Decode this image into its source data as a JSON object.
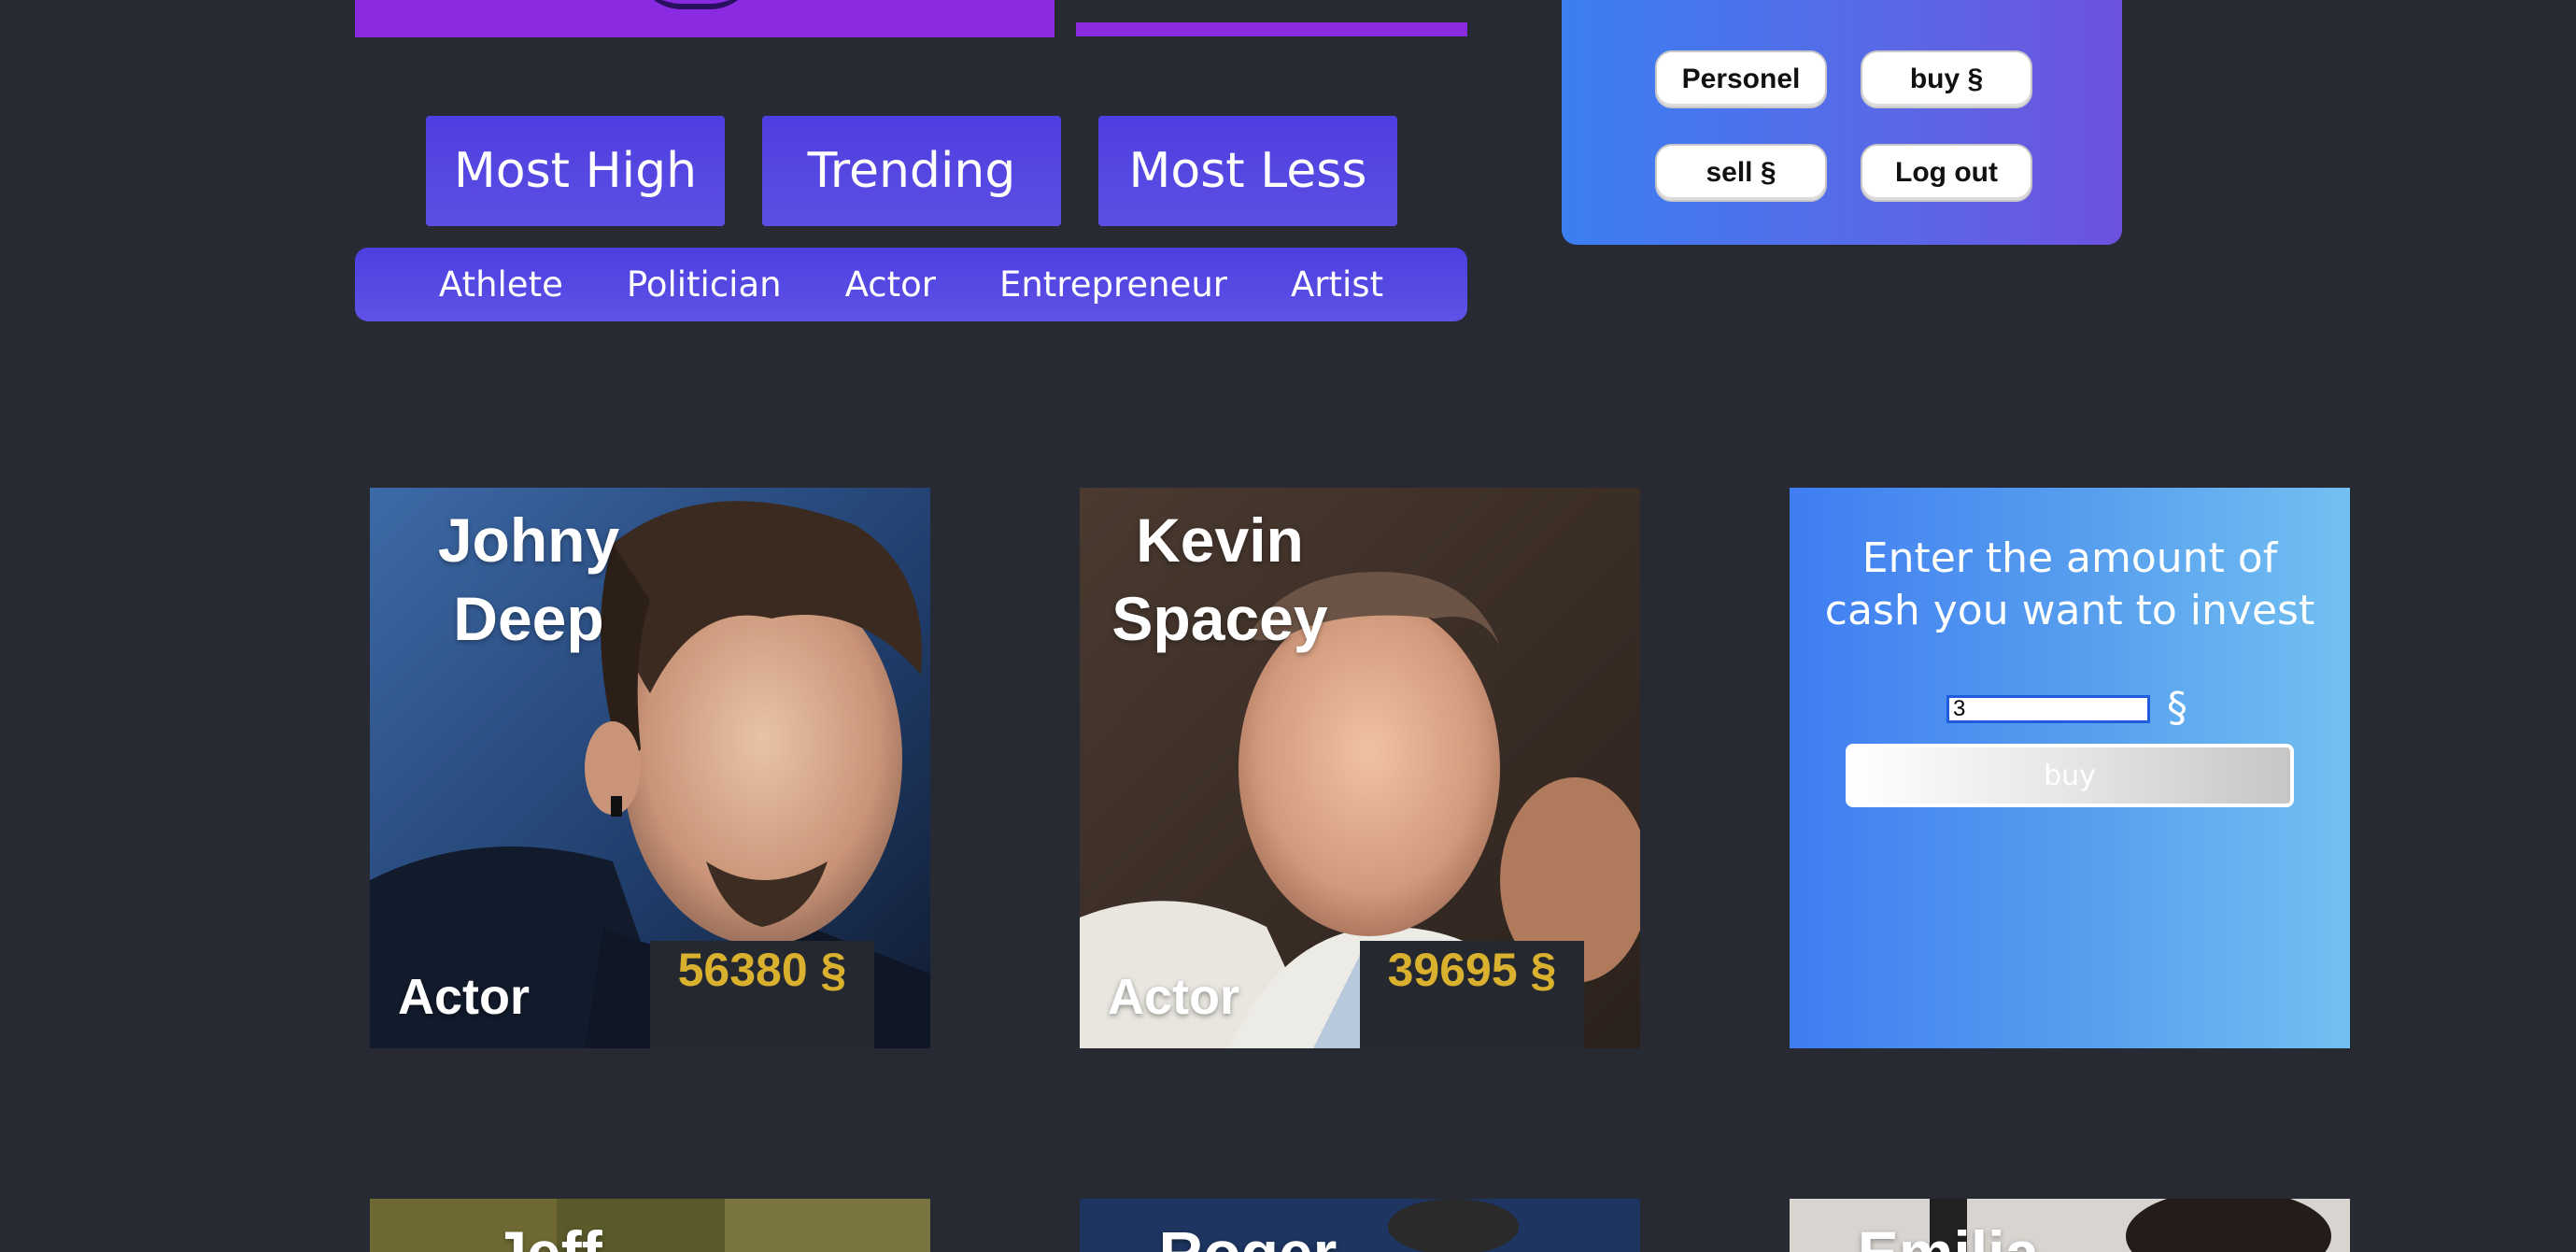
{
  "sort_buttons": [
    {
      "label": "Most High"
    },
    {
      "label": "Trending"
    },
    {
      "label": "Most Less"
    }
  ],
  "categories": [
    "Athlete",
    "Politician",
    "Actor",
    "Entrepreneur",
    "Artist"
  ],
  "user_menu": {
    "personel": "Personel",
    "buy": "buy §",
    "sell": "sell §",
    "logout": "Log out"
  },
  "cards": [
    {
      "first": "Johny",
      "last": "Deep",
      "category": "Actor",
      "price": "56380 §"
    },
    {
      "first": "Kevin",
      "last": "Spacey",
      "category": "Actor",
      "price": "39695 §"
    }
  ],
  "next_cards": [
    {
      "first": "Jeff"
    },
    {
      "first": "Roger"
    },
    {
      "first": "Emilia"
    }
  ],
  "invest": {
    "prompt": "Enter the amount of cash you want to invest",
    "amount_value": "3",
    "currency": "§",
    "buy_label": "buy"
  },
  "colors": {
    "background": "#282a33",
    "accent_purple": "#8a2be2",
    "button_indigo": "#5b4fe3",
    "price_gold": "#d9b12f"
  }
}
